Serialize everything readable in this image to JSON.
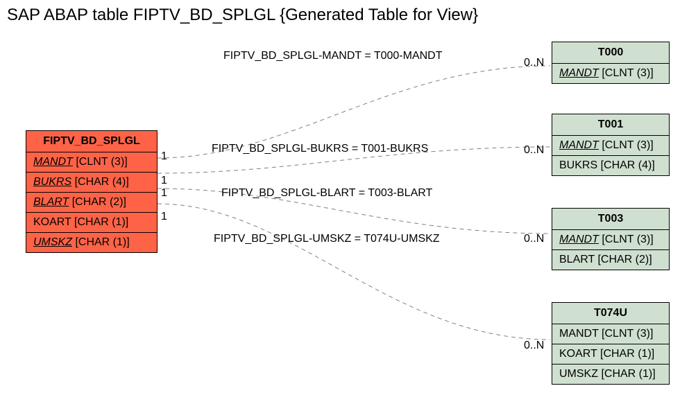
{
  "title": "SAP ABAP table FIPTV_BD_SPLGL {Generated Table for View}",
  "main": {
    "name": "FIPTV_BD_SPLGL",
    "fields": [
      {
        "fk": true,
        "label": "MANDT",
        "type": "[CLNT (3)]"
      },
      {
        "fk": true,
        "label": "BUKRS",
        "type": "[CHAR (4)]"
      },
      {
        "fk": true,
        "label": "BLART",
        "type": "[CHAR (2)]"
      },
      {
        "fk": false,
        "label": "KOART",
        "type": "[CHAR (1)]"
      },
      {
        "fk": true,
        "label": "UMSKZ",
        "type": "[CHAR (1)]"
      }
    ]
  },
  "refs": [
    {
      "name": "T000",
      "fields": [
        {
          "fk": true,
          "label": "MANDT",
          "type": "[CLNT (3)]"
        }
      ]
    },
    {
      "name": "T001",
      "fields": [
        {
          "fk": true,
          "label": "MANDT",
          "type": "[CLNT (3)]"
        },
        {
          "fk": false,
          "label": "BUKRS",
          "type": "[CHAR (4)]"
        }
      ]
    },
    {
      "name": "T003",
      "fields": [
        {
          "fk": true,
          "label": "MANDT",
          "type": "[CLNT (3)]"
        },
        {
          "fk": false,
          "label": "BLART",
          "type": "[CHAR (2)]"
        }
      ]
    },
    {
      "name": "T074U",
      "fields": [
        {
          "fk": false,
          "label": "MANDT",
          "type": "[CLNT (3)]"
        },
        {
          "fk": false,
          "label": "KOART",
          "type": "[CHAR (1)]"
        },
        {
          "fk": false,
          "label": "UMSKZ",
          "type": "[CHAR (1)]"
        }
      ]
    }
  ],
  "relations": [
    {
      "text": "FIPTV_BD_SPLGL-MANDT = T000-MANDT",
      "left": "1",
      "right": "0..N"
    },
    {
      "text": "FIPTV_BD_SPLGL-BUKRS = T001-BUKRS",
      "left": "1",
      "right": "0..N"
    },
    {
      "text": "FIPTV_BD_SPLGL-BLART = T003-BLART",
      "left": "1",
      "right": ""
    },
    {
      "text": "FIPTV_BD_SPLGL-UMSKZ = T074U-UMSKZ",
      "left": "1",
      "right": "0..N"
    }
  ],
  "extraCards": {
    "t003_right": "0..N",
    "t074u_right": "0..N"
  },
  "chart_data": {
    "type": "table",
    "description": "Entity-relationship diagram linking view FIPTV_BD_SPLGL to base tables via foreign keys",
    "entities": [
      {
        "name": "FIPTV_BD_SPLGL",
        "role": "view",
        "fields": [
          "MANDT CLNT(3)",
          "BUKRS CHAR(4)",
          "BLART CHAR(2)",
          "KOART CHAR(1)",
          "UMSKZ CHAR(1)"
        ]
      },
      {
        "name": "T000",
        "role": "ref",
        "fields": [
          "MANDT CLNT(3)"
        ]
      },
      {
        "name": "T001",
        "role": "ref",
        "fields": [
          "MANDT CLNT(3)",
          "BUKRS CHAR(4)"
        ]
      },
      {
        "name": "T003",
        "role": "ref",
        "fields": [
          "MANDT CLNT(3)",
          "BLART CHAR(2)"
        ]
      },
      {
        "name": "T074U",
        "role": "ref",
        "fields": [
          "MANDT CLNT(3)",
          "KOART CHAR(1)",
          "UMSKZ CHAR(1)"
        ]
      }
    ],
    "relations": [
      {
        "from": "FIPTV_BD_SPLGL.MANDT",
        "to": "T000.MANDT",
        "card_from": "1",
        "card_to": "0..N"
      },
      {
        "from": "FIPTV_BD_SPLGL.BUKRS",
        "to": "T001.BUKRS",
        "card_from": "1",
        "card_to": "0..N"
      },
      {
        "from": "FIPTV_BD_SPLGL.BLART",
        "to": "T003.BLART",
        "card_from": "1",
        "card_to": "0..N"
      },
      {
        "from": "FIPTV_BD_SPLGL.UMSKZ",
        "to": "T074U.UMSKZ",
        "card_from": "1",
        "card_to": "0..N"
      }
    ]
  }
}
